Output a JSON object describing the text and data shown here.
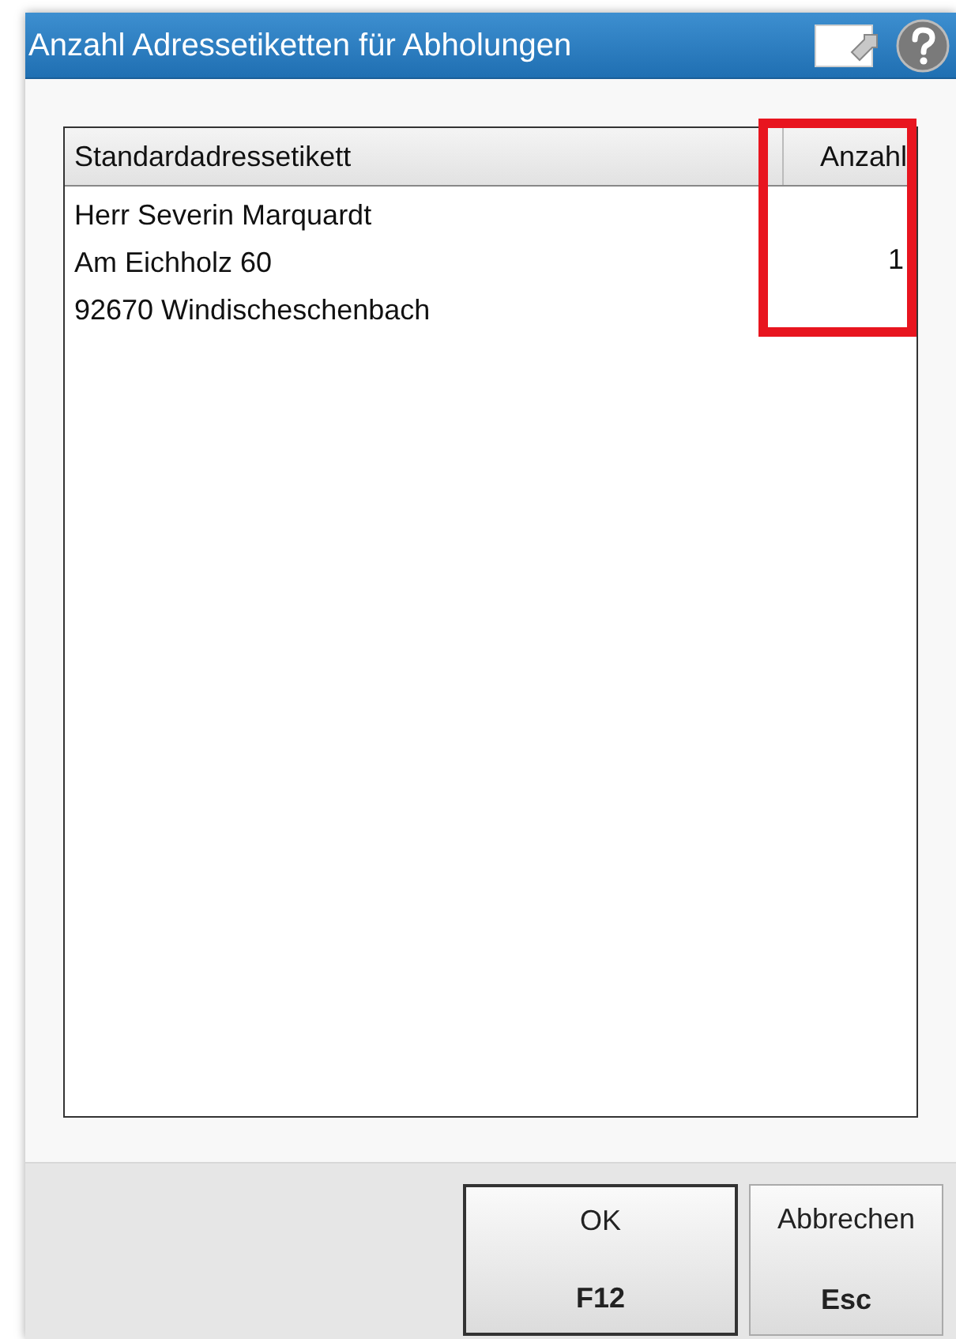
{
  "window": {
    "title": "Anzahl Adressetiketten für Abholungen"
  },
  "table": {
    "columns": [
      {
        "label": "Standardadressetikett",
        "highlighted": false
      },
      {
        "label": "Anzahl",
        "highlighted": true
      }
    ],
    "rows": [
      {
        "lines": [
          "Herr Severin Marquardt",
          "Am Eichholz 60",
          "92670 Windischeschenbach"
        ],
        "count": "1"
      }
    ]
  },
  "buttons": [
    {
      "label": "OK",
      "key": "F12",
      "default": true
    },
    {
      "label": "Abbrechen",
      "key": "Esc",
      "default": false
    }
  ]
}
